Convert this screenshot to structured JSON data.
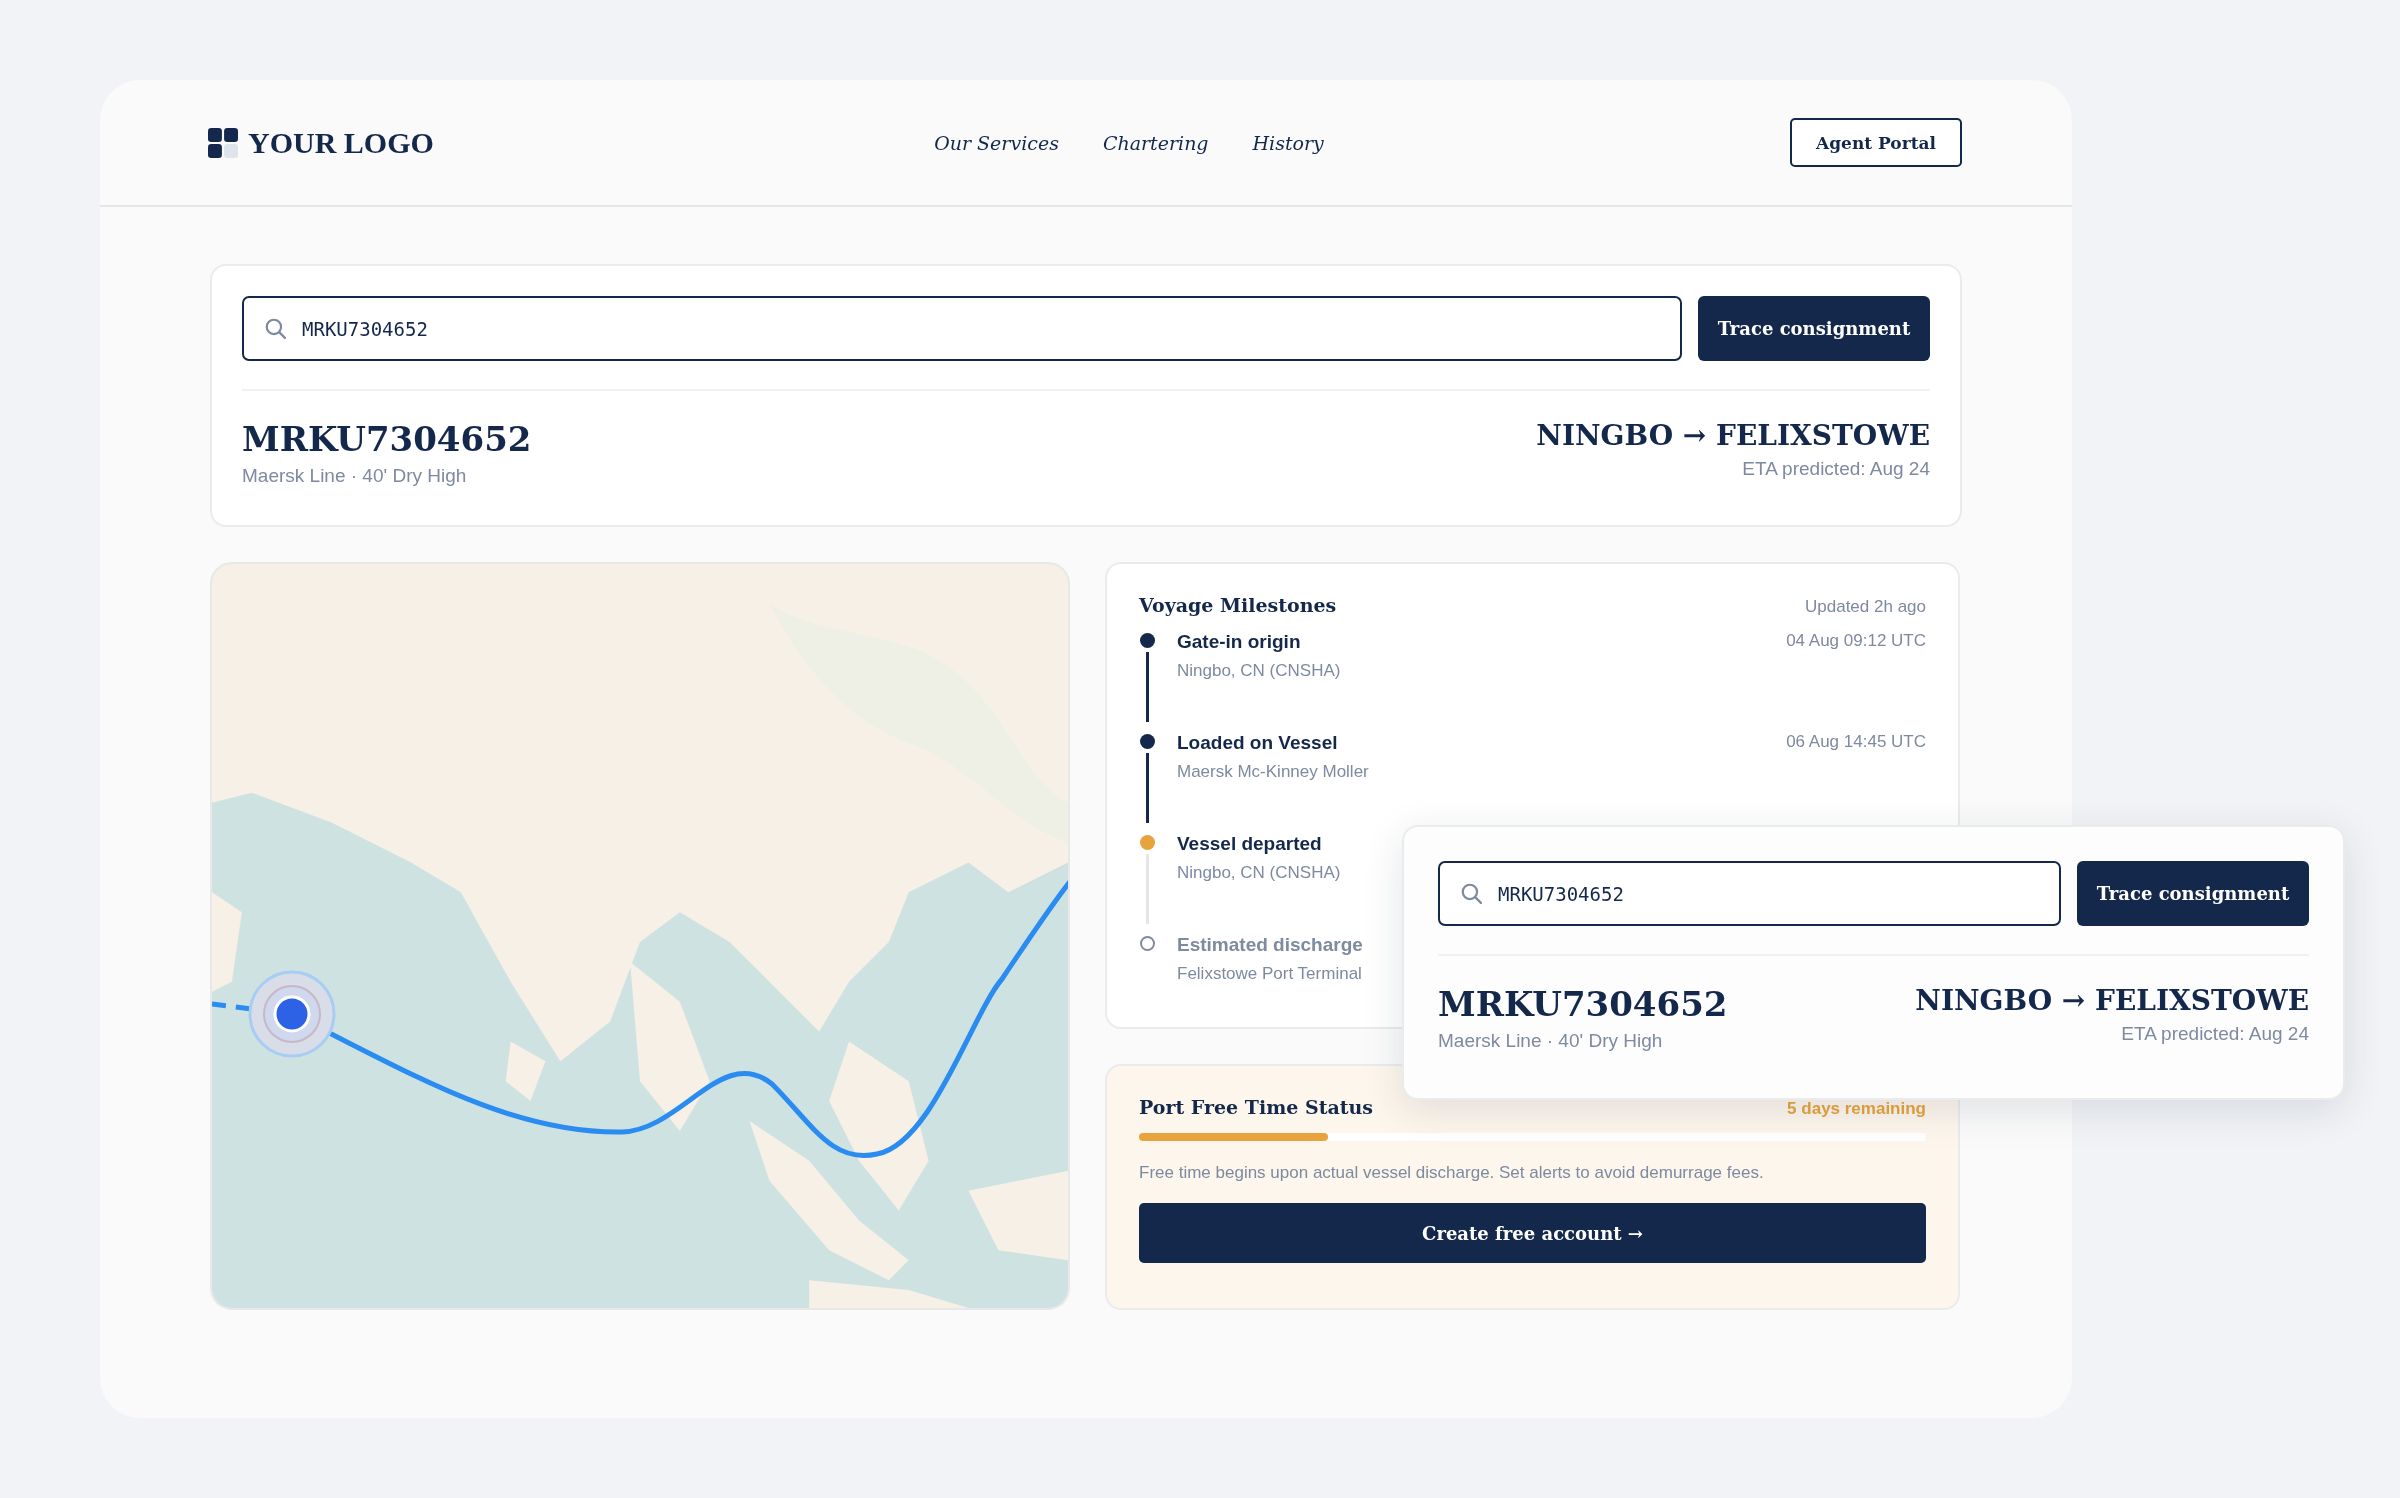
{
  "header": {
    "logo": "YOUR LOGO",
    "nav": [
      "Our Services",
      "Chartering",
      "History"
    ],
    "portal_button": "Agent Portal"
  },
  "search_card": {
    "query": "MRKU7304652",
    "button": "Trace consignment",
    "container_id": "MRKU7304652",
    "details": "Maersk Line · 40' Dry High",
    "route": "NINGBO → FELIXSTOWE",
    "eta": "ETA predicted: Aug 24"
  },
  "milestones": {
    "title": "Voyage Milestones",
    "updated": "Updated 2h ago",
    "items": [
      {
        "kind": "done",
        "title": "Gate-in origin",
        "place": "Ningbo, CN (CNSHA)",
        "time": "04 Aug 09:12 UTC"
      },
      {
        "kind": "done",
        "title": "Loaded on Vessel",
        "place": "Maersk Mc-Kinney Moller",
        "time": "06 Aug 14:45 UTC"
      },
      {
        "kind": "current",
        "title": "Vessel departed",
        "place": "Ningbo, CN (CNSHA)"
      },
      {
        "kind": "pending",
        "title": "Estimated discharge",
        "place": "Felixstowe Port Terminal"
      }
    ]
  },
  "free_time": {
    "title": "Port Free Time Status",
    "remaining": "5 days remaining",
    "level": 0.24,
    "note": "Free time begins upon actual vessel discharge. Set alerts to avoid demurrage fees.",
    "button": "Create free account →"
  },
  "floating_card": {
    "query": "MRKU7304652",
    "button": "Trace consignment",
    "container_id": "MRKU7304652",
    "details": "Maersk Line · 40' Dry High",
    "route": "NINGBO → FELIXSTOWE",
    "eta": "ETA predicted: Aug 24"
  }
}
